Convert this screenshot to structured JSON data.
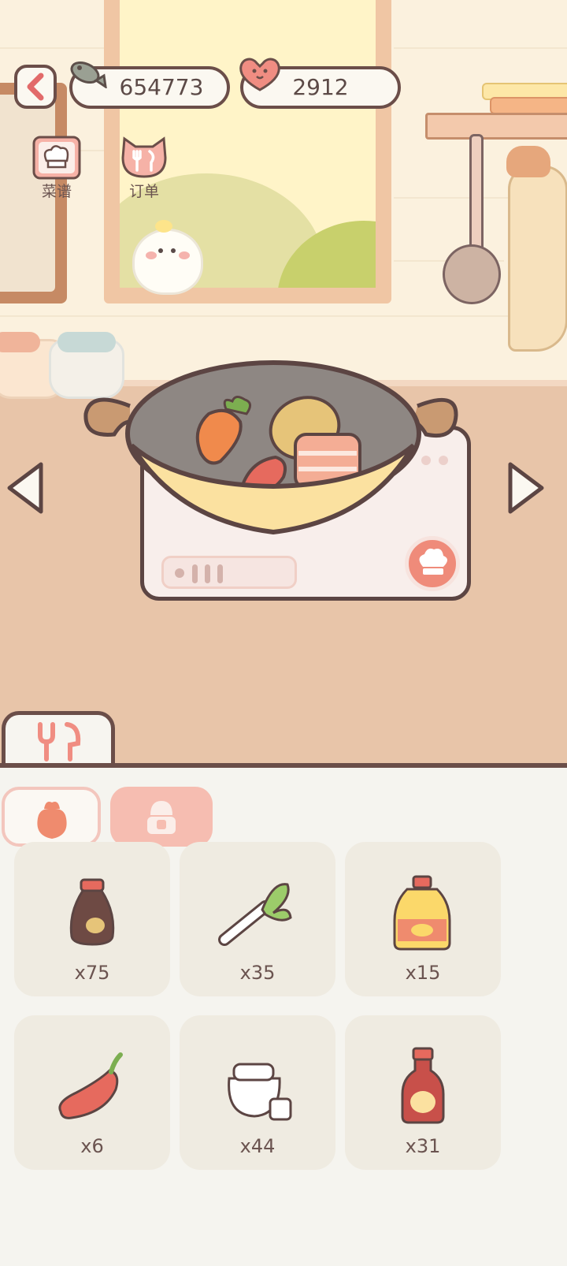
{
  "hud": {
    "back_icon": "back-chevron-icon",
    "fish_coins": "654773",
    "hearts": "2912"
  },
  "side_buttons": {
    "recipes_label": "菜谱",
    "orders_label": "订单"
  },
  "wok": {
    "ingredients": [
      "carrot-icon",
      "potato-icon",
      "chili-icon",
      "pork-belly-icon"
    ]
  },
  "panel": {
    "tab_icon": "cutlery-icon",
    "categories": [
      {
        "icon": "vegetable-bag-icon",
        "active": true
      },
      {
        "icon": "seasoning-shaker-icon",
        "active": false
      }
    ],
    "items": [
      {
        "icon": "soy-sauce-icon",
        "count": "x75"
      },
      {
        "icon": "green-onion-icon",
        "count": "x35"
      },
      {
        "icon": "cooking-oil-icon",
        "count": "x15"
      },
      {
        "icon": "chili-pepper-icon",
        "count": "x6"
      },
      {
        "icon": "sugar-jar-icon",
        "count": "x44"
      },
      {
        "icon": "vinegar-bottle-icon",
        "count": "x31"
      }
    ]
  },
  "colors": {
    "outline": "#6b4e49",
    "accent": "#ef8b7a",
    "panel_bg": "#f5f4ef",
    "counter": "#e8c5a9"
  }
}
